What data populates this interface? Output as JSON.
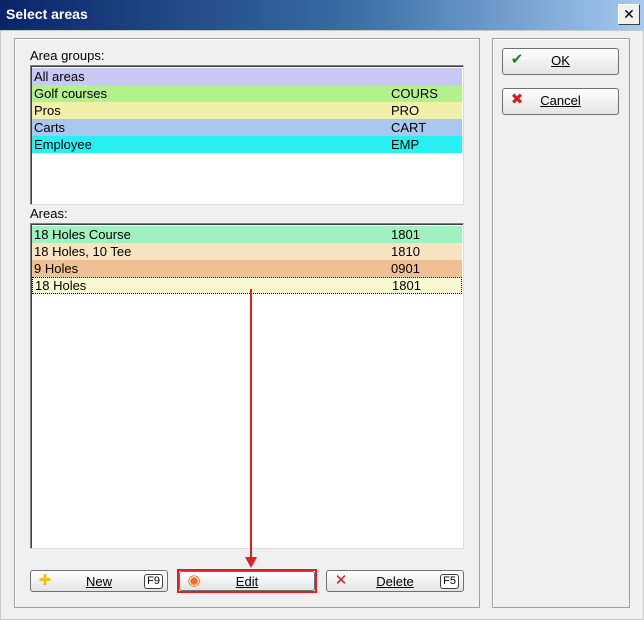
{
  "window": {
    "title": "Select areas",
    "close_glyph": "✕"
  },
  "area_groups": {
    "label": "Area groups:",
    "rows": [
      {
        "name": "All areas",
        "code": "",
        "color": "#c8c8f4"
      },
      {
        "name": "Golf courses",
        "code": "COURS",
        "color": "#b4f08c"
      },
      {
        "name": "Pros",
        "code": "PRO",
        "color": "#f0f0a8"
      },
      {
        "name": "Carts",
        "code": "CART",
        "color": "#a8c8f0"
      },
      {
        "name": "Employee",
        "code": "EMP",
        "color": "#28f0f0"
      }
    ]
  },
  "areas": {
    "label": "Areas:",
    "rows": [
      {
        "name": "18 Holes Course",
        "code": "1801",
        "color": "#a0f0c0"
      },
      {
        "name": "18 Holes, 10 Tee",
        "code": "1810",
        "color": "#f8e4c0"
      },
      {
        "name": "9 Holes",
        "code": "0901",
        "color": "#f0c094"
      },
      {
        "name": "18 Holes",
        "code": "1801",
        "color": "#fafad2",
        "selected": true
      }
    ]
  },
  "buttons": {
    "ok": {
      "label": "OK",
      "icon": "checkmark-icon",
      "icon_glyph": "✔",
      "icon_color": "#208020"
    },
    "cancel": {
      "label": "Cancel",
      "icon": "x-icon",
      "icon_glyph": "✖",
      "icon_color": "#d02020"
    },
    "new": {
      "label": "New",
      "key": "F9",
      "icon": "plus-icon",
      "icon_glyph": "✚",
      "icon_color": "#f0c020"
    },
    "edit": {
      "label": "Edit",
      "icon": "circle-icon",
      "icon_glyph": "◉",
      "icon_color": "#f07020"
    },
    "delete": {
      "label": "Delete",
      "key": "F5",
      "icon": "delete-x-icon",
      "icon_glyph": "✕",
      "icon_color": "#d02020"
    }
  },
  "annotation": {
    "highlight_color": "#e02020"
  }
}
